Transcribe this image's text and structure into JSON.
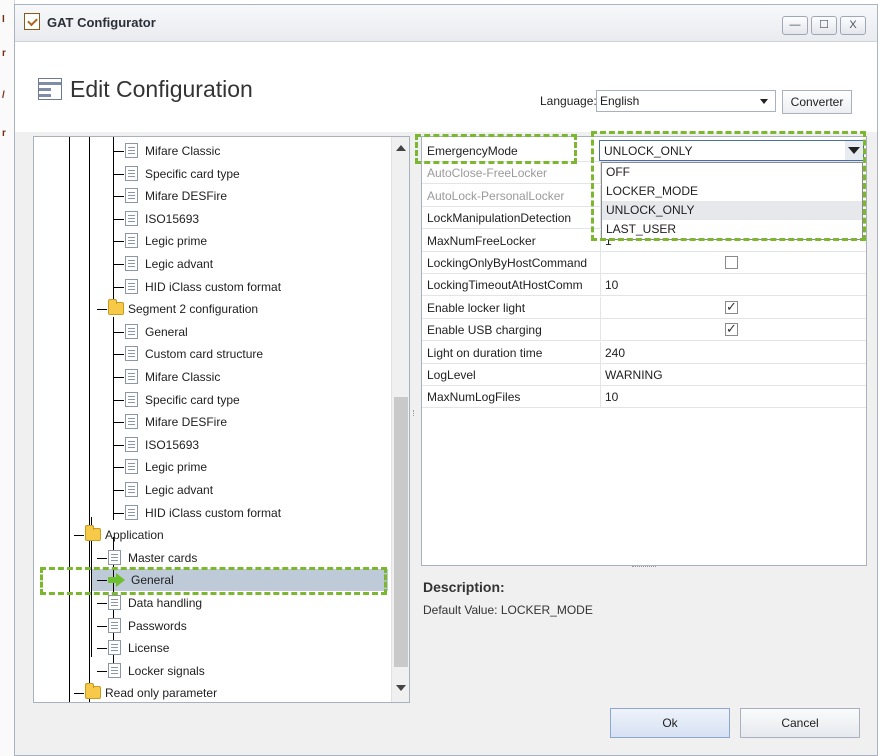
{
  "window": {
    "title": "GAT Configurator",
    "minimize_label": "—",
    "maximize_label": "☐",
    "close_label": "X"
  },
  "header": {
    "title": "Edit Configuration",
    "language_label": "Language:",
    "language_value": "English",
    "converter_label": "Converter"
  },
  "tree": {
    "items": [
      {
        "label": "Mifare Classic",
        "icon": "page-icon"
      },
      {
        "label": "Specific card type",
        "icon": "page-icon"
      },
      {
        "label": "Mifare DESFire",
        "icon": "page-icon"
      },
      {
        "label": "ISO15693",
        "icon": "page-icon"
      },
      {
        "label": "Legic prime",
        "icon": "page-icon"
      },
      {
        "label": "Legic advant",
        "icon": "page-icon"
      },
      {
        "label": "HID iClass custom format",
        "icon": "page-icon"
      },
      {
        "label": "Segment 2 configuration",
        "icon": "folder-icon"
      },
      {
        "label": "General",
        "icon": "page-icon"
      },
      {
        "label": "Custom card structure",
        "icon": "page-icon"
      },
      {
        "label": "Mifare Classic",
        "icon": "page-icon"
      },
      {
        "label": "Specific card type",
        "icon": "page-icon"
      },
      {
        "label": "Mifare DESFire",
        "icon": "page-icon"
      },
      {
        "label": "ISO15693",
        "icon": "page-icon"
      },
      {
        "label": "Legic prime",
        "icon": "page-icon"
      },
      {
        "label": "Legic advant",
        "icon": "page-icon"
      },
      {
        "label": "HID iClass custom format",
        "icon": "page-icon"
      },
      {
        "label": "Application",
        "icon": "folder-icon"
      },
      {
        "label": "Master cards",
        "icon": "page-icon"
      },
      {
        "label": "General",
        "icon": "arrow-right-icon",
        "selected": true
      },
      {
        "label": "Data handling",
        "icon": "page-icon"
      },
      {
        "label": "Passwords",
        "icon": "page-icon"
      },
      {
        "label": "License",
        "icon": "page-icon"
      },
      {
        "label": "Locker signals",
        "icon": "page-icon"
      },
      {
        "label": "Read only parameter",
        "icon": "folder-icon"
      }
    ]
  },
  "properties": {
    "rows": [
      {
        "name": "EmergencyMode",
        "value": "UNLOCK_ONLY"
      },
      {
        "name": "AutoClose-FreeLocker",
        "value": "",
        "disabled": true
      },
      {
        "name": "AutoLock-PersonalLocker",
        "value": "",
        "disabled": true
      },
      {
        "name": "LockManipulationDetection",
        "value": ""
      },
      {
        "name": "MaxNumFreeLocker",
        "value": "1"
      },
      {
        "name": "LockingOnlyByHostCommand",
        "value": "",
        "checkbox": false
      },
      {
        "name": "LockingTimeoutAtHostComm",
        "value": "10"
      },
      {
        "name": "Enable locker light",
        "value": "",
        "checkbox": true
      },
      {
        "name": "Enable USB charging",
        "value": "",
        "checkbox": true
      },
      {
        "name": "Light on duration time",
        "value": "240"
      },
      {
        "name": "LogLevel",
        "value": "WARNING"
      },
      {
        "name": "MaxNumLogFiles",
        "value": "10"
      }
    ],
    "dropdown_value": "UNLOCK_ONLY",
    "dropdown_options": [
      "OFF",
      "LOCKER_MODE",
      "UNLOCK_ONLY",
      "LAST_USER"
    ],
    "dropdown_highlighted": "UNLOCK_ONLY"
  },
  "description": {
    "title": "Description:",
    "body": "Default Value: LOCKER_MODE"
  },
  "footer": {
    "ok_label": "Ok",
    "cancel_label": "Cancel"
  },
  "colors": {
    "annotation": "#7cb82f",
    "selection": "#bfcad8",
    "folder": "#f7c948",
    "arrow": "#6cbf2d"
  }
}
